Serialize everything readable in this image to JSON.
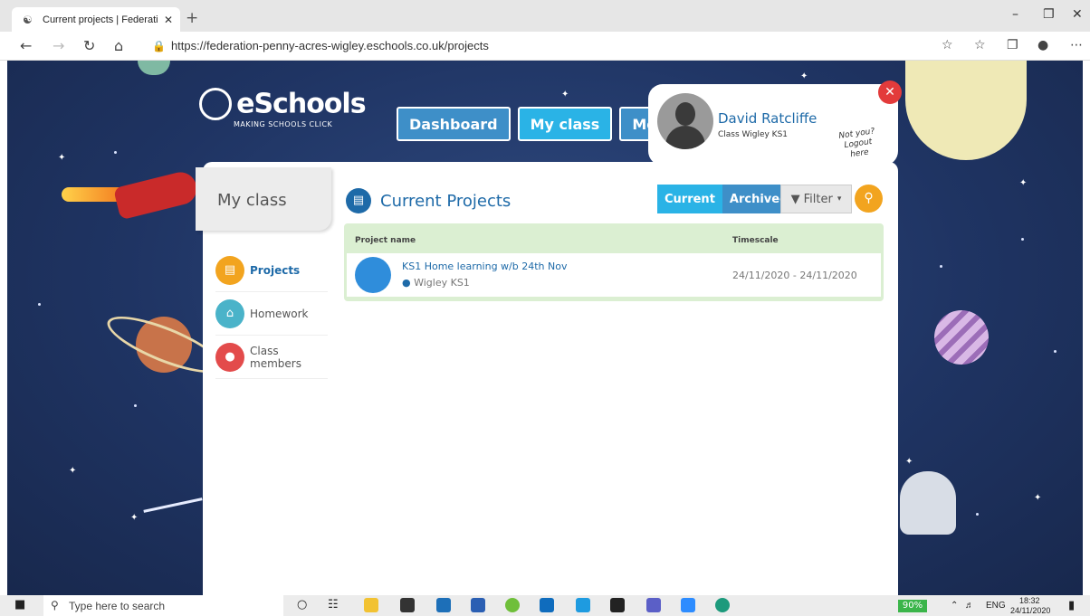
{
  "browser": {
    "tab_title": "Current projects | Federation of Penny Acres",
    "url": "https://federation-penny-acres-wigley.eschools.co.uk/projects"
  },
  "logo": {
    "name": "eSchools",
    "tagline": "MAKING SCHOOLS CLICK"
  },
  "topnav": [
    {
      "label": "Dashboard",
      "active": false
    },
    {
      "label": "My class",
      "active": true
    },
    {
      "label": "Me",
      "active": false
    }
  ],
  "user": {
    "name": "David Ratcliffe",
    "class": "Class Wigley KS1",
    "logout_hint": "Not you? Logout here"
  },
  "sidebar": {
    "title": "My class",
    "items": [
      {
        "label": "Projects",
        "icon": "book-icon",
        "color": "#f2a41f",
        "active": true
      },
      {
        "label": "Homework",
        "icon": "house-icon",
        "color": "#4ab3c9",
        "active": false
      },
      {
        "label": "Class members",
        "icon": "people-icon",
        "color": "#e34b4b",
        "active": false
      }
    ]
  },
  "projects": {
    "heading": "Current Projects",
    "toggle": [
      {
        "label": "Current",
        "color": "#2ab3e6"
      },
      {
        "label": "Archived",
        "color": "#3e8fc8"
      }
    ],
    "filter_label": "Filter",
    "columns": [
      "Project name",
      "Timescale"
    ],
    "rows": [
      {
        "name": "KS1 Home learning w/b 24th Nov",
        "class": "Wigley KS1",
        "timescale": "24/11/2020 - 24/11/2020"
      }
    ]
  },
  "taskbar": {
    "search_placeholder": "Type here to search",
    "battery": "90%",
    "lang": "ENG",
    "time": "18:32",
    "date": "24/11/2020"
  }
}
